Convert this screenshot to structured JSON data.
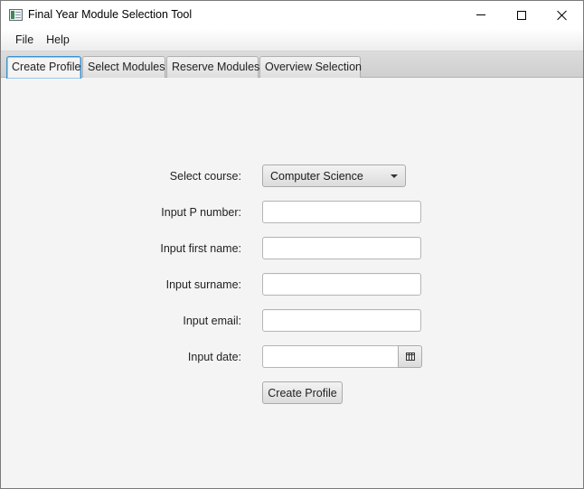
{
  "window": {
    "title": "Final Year Module Selection Tool",
    "icon": "app-window-icon"
  },
  "menu": {
    "items": [
      "File",
      "Help"
    ]
  },
  "tabs": [
    {
      "label": "Create Profile",
      "active": true
    },
    {
      "label": "Select Modules",
      "active": false
    },
    {
      "label": "Reserve Modules",
      "active": false
    },
    {
      "label": "Overview Selection",
      "active": false
    }
  ],
  "form": {
    "course": {
      "label": "Select course:",
      "selected": "Computer Science"
    },
    "pnumber": {
      "label": "Input P number:",
      "value": ""
    },
    "firstname": {
      "label": "Input first name:",
      "value": ""
    },
    "surname": {
      "label": "Input surname:",
      "value": ""
    },
    "email": {
      "label": "Input email:",
      "value": ""
    },
    "date": {
      "label": "Input date:",
      "value": ""
    },
    "submit_label": "Create Profile"
  },
  "colors": {
    "accent": "#3a92d0",
    "background": "#f4f4f4"
  }
}
